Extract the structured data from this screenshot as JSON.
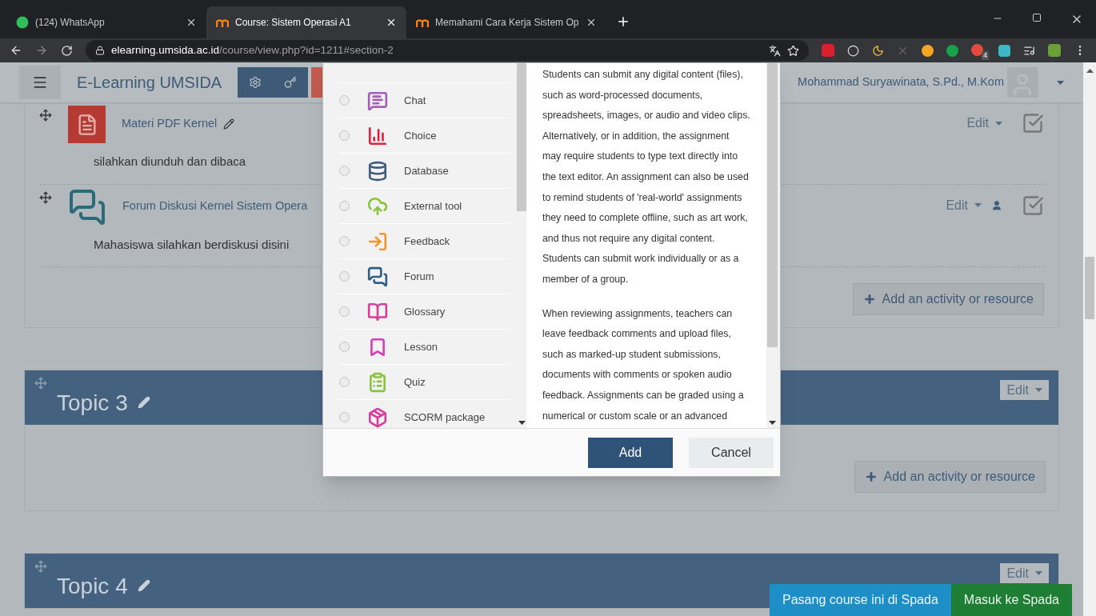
{
  "browser": {
    "tabs": [
      {
        "title": "(124) WhatsApp",
        "kind": "whatsapp",
        "selected": false
      },
      {
        "title": "Course: Sistem Operasi A1",
        "kind": "moodle",
        "selected": true
      },
      {
        "title": "Memahami Cara Kerja Sistem Op",
        "kind": "moodle",
        "selected": false
      }
    ],
    "url_host": "elearning.umsida.ac.id",
    "url_path": "/course/view.php?id=1211#section-2",
    "extension_badge": "4"
  },
  "navbar": {
    "site_name": "E-Learning UMSIDA",
    "user_name": "Mohammad Suryawinata, S.Pd., M.Kom"
  },
  "section": {
    "activities": [
      {
        "kind": "pdf",
        "name": "Materi PDF Kernel",
        "description": "silahkan diunduh dan dibaca",
        "edit": "Edit",
        "completion": true,
        "restricted": false
      },
      {
        "kind": "forum",
        "name": "Forum Diskusi Kernel Sistem Opera",
        "description": "Mahasiswa silahkan berdiskusi disini",
        "edit": "Edit",
        "completion": true,
        "restricted": true
      }
    ],
    "add_label": "Add an activity or resource"
  },
  "topics": [
    {
      "title": "Topic 3",
      "edit": "Edit",
      "add_label": "Add an activity or resource"
    },
    {
      "title": "Topic 4",
      "edit": "Edit"
    }
  ],
  "dialog": {
    "modules": [
      {
        "kind": "chat",
        "name": "Chat",
        "color": "#a35fb3",
        "selected": false
      },
      {
        "kind": "choice",
        "name": "Choice",
        "color": "#e0203a",
        "selected": false
      },
      {
        "kind": "database",
        "name": "Database",
        "color": "#3f5b7e",
        "selected": false
      },
      {
        "kind": "external",
        "name": "External tool",
        "color": "#8ac33f",
        "selected": false
      },
      {
        "kind": "feedback",
        "name": "Feedback",
        "color": "#f0962f",
        "selected": false
      },
      {
        "kind": "forum",
        "name": "Forum",
        "color": "#2f5d86",
        "selected": false
      },
      {
        "kind": "glossary",
        "name": "Glossary",
        "color": "#d83d9b",
        "selected": false
      },
      {
        "kind": "lesson",
        "name": "Lesson",
        "color": "#d33fb4",
        "selected": false
      },
      {
        "kind": "quiz",
        "name": "Quiz",
        "color": "#8ac33f",
        "selected": false
      },
      {
        "kind": "scorm",
        "name": "SCORM package",
        "color": "#d83d9b",
        "selected": false
      }
    ],
    "description": [
      "Students can submit any digital content (files), such as word-processed documents, spreadsheets, images, or audio and video clips. Alternatively, or in addition, the assignment may require students to type text directly into the text editor. An assignment can also be used to remind students of 'real-world' assignments they need to complete offline, such as art work, and thus not require any digital content. Students can submit work individually or as a member of a group.",
      "When reviewing assignments, teachers can leave feedback comments and upload files, such as marked-up student submissions, documents with comments or spoken audio feedback. Assignments can be graded using a numerical or custom scale or an advanced"
    ],
    "add": "Add",
    "cancel": "Cancel"
  },
  "footer_buttons": [
    {
      "kind": "primary",
      "label": "Pasang course ini di Spada"
    },
    {
      "kind": "success",
      "label": "Masuk ke Spada"
    }
  ]
}
